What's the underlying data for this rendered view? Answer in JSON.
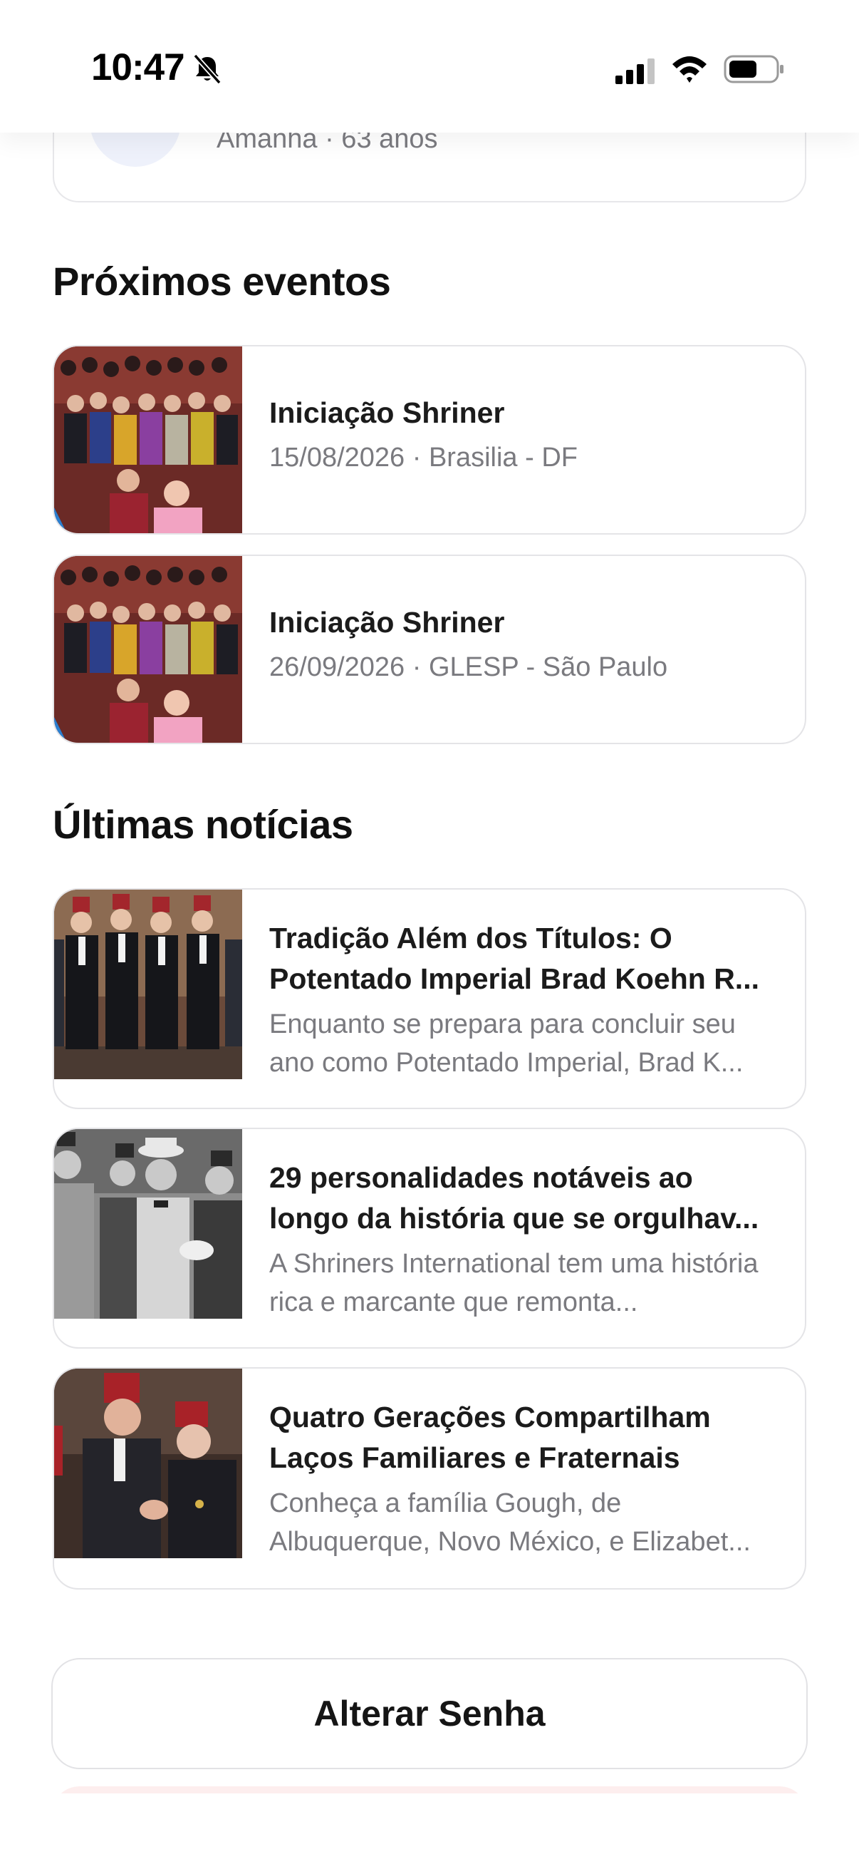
{
  "status_bar": {
    "time": "10:47",
    "icons": [
      "bell-slash-icon",
      "cellular-signal-icon",
      "wifi-icon",
      "battery-icon"
    ]
  },
  "birthday": {
    "subtitle": "Amanhã · 63 anos"
  },
  "events": {
    "title": "Próximos eventos",
    "items": [
      {
        "title": "Iniciação Shriner",
        "subtitle": "15/08/2026 · Brasilia - DF"
      },
      {
        "title": "Iniciação Shriner",
        "subtitle": "26/09/2026 · GLESP - São Paulo"
      }
    ]
  },
  "news": {
    "title": "Últimas notícias",
    "items": [
      {
        "title": "Tradição Além dos Títulos: O Potentado Imperial Brad Koehn R...",
        "excerpt": "Enquanto se prepara para concluir seu ano como Potentado Imperial, Brad K..."
      },
      {
        "title": "29 personalidades notáveis ao longo da história que se orgulhav...",
        "excerpt": "A Shriners International tem uma história rica e marcante que remonta..."
      },
      {
        "title": "Quatro Gerações Compartilham Laços Familiares e Fraternais",
        "excerpt": "Conheça a família Gough, de Albuquerque, Novo México, e Elizabet..."
      }
    ]
  },
  "actions": {
    "change_password": "Alterar Senha"
  }
}
